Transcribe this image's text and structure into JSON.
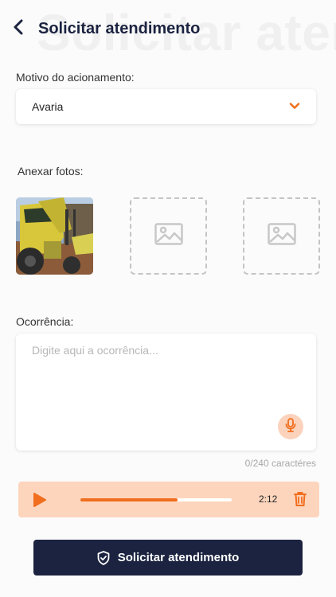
{
  "header": {
    "title": "Solicitar atendimento",
    "watermark": "Solicitar atendimento",
    "back_icon": "chevron-left-icon"
  },
  "motivo": {
    "label": "Motivo do acionamento:",
    "value": "Avaria",
    "icon": "chevron-down-icon"
  },
  "fotos": {
    "label": "Anexar fotos:",
    "placeholder_icon": "image-icon"
  },
  "ocorrencia": {
    "label": "Ocorrência:",
    "placeholder": "Digite aqui a ocorrência...",
    "value": "",
    "counter": "0/240 caractéres",
    "mic_icon": "microphone-icon"
  },
  "audio": {
    "duration": "2:12",
    "progress": 0.64,
    "play_icon": "play-icon",
    "delete_icon": "trash-icon"
  },
  "submit": {
    "label": "Solicitar atendimento",
    "icon": "shield-check-icon"
  },
  "colors": {
    "primary": "#1b2340",
    "accent": "#f06e1d",
    "accent_light": "#fdd5bd"
  }
}
